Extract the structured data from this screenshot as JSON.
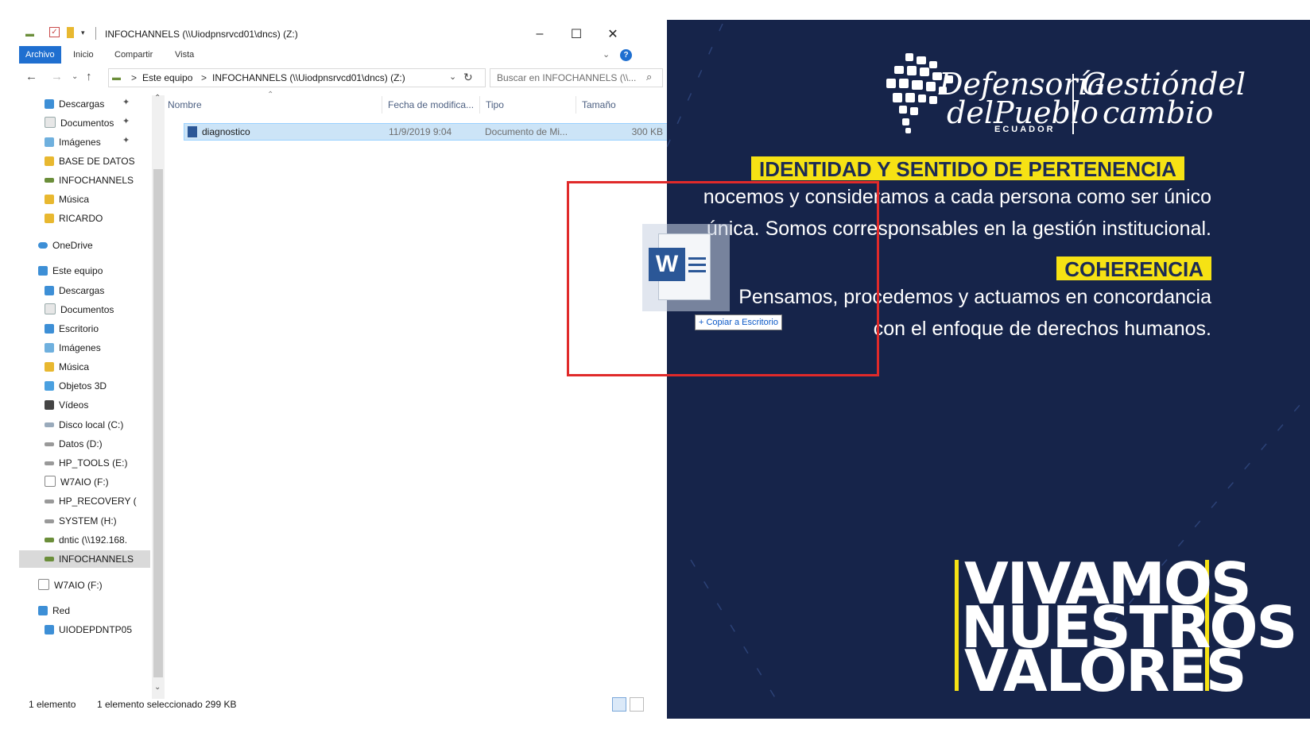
{
  "window": {
    "title": "INFOCHANNELS (\\\\Uiodpnsrvcd01\\dncs) (Z:)",
    "minimize": "–",
    "maximize": "☐",
    "close": "✕"
  },
  "ribbon": {
    "tabs": [
      "Archivo",
      "Inicio",
      "Compartir",
      "Vista"
    ],
    "help": "?"
  },
  "address": {
    "path": [
      "Este equipo",
      "INFOCHANNELS (\\\\Uiodpnsrvcd01\\dncs) (Z:)"
    ],
    "separator": ">",
    "search_placeholder": "Buscar en INFOCHANNELS (\\\\..."
  },
  "nav": {
    "quick_access": [
      "Descargas",
      "Documentos",
      "Imágenes",
      "BASE DE DATOS",
      "INFOCHANNELS",
      "Música",
      "RICARDO"
    ],
    "onedrive": "OneDrive",
    "this_pc": "Este equipo",
    "this_pc_items": [
      "Descargas",
      "Documentos",
      "Escritorio",
      "Imágenes",
      "Música",
      "Objetos 3D",
      "Vídeos",
      "Disco local (C:)",
      "Datos (D:)",
      "HP_TOOLS (E:)",
      "W7AIO (F:)",
      "HP_RECOVERY (",
      "SYSTEM (H:)",
      "dntic (\\\\192.168.",
      "INFOCHANNELS"
    ],
    "w7aio": "W7AIO (F:)",
    "network": "Red",
    "network_items": [
      "UIODEPDNTP05"
    ]
  },
  "columns": [
    "Nombre",
    "Fecha de modifica...",
    "Tipo",
    "Tamaño"
  ],
  "files": [
    {
      "name": "diagnostico",
      "date": "11/9/2019 9:04",
      "type": "Documento de Mi...",
      "size": "300 KB"
    }
  ],
  "status": {
    "count": "1 elemento",
    "selected": "1 elemento seleccionado  299 KB"
  },
  "wallpaper": {
    "logo_left_line1": "Defensoría",
    "logo_left_line2": "delPueblo",
    "logo_country": "ECUADOR",
    "logo_right_line1": "Gestióndel",
    "logo_right_line2": "cambio",
    "value1_title": "IDENTIDAD Y SENTIDO DE PERTENENCIA",
    "value1_line1": "nocemos y consideramos a cada persona como ser único",
    "value1_line2": "única. Somos corresponsables en la gestión institucional.",
    "value2_title": "COHERENCIA",
    "value2_line1": "Pensamos, procedemos y actuamos en concordancia",
    "value2_line2": "con el enfoque de derechos humanos.",
    "slogan": [
      "VIVAMOS",
      "NUESTROS",
      "VALORES"
    ]
  },
  "drag": {
    "icon_letter": "W",
    "tooltip": "+ Copiar a Escritorio"
  }
}
